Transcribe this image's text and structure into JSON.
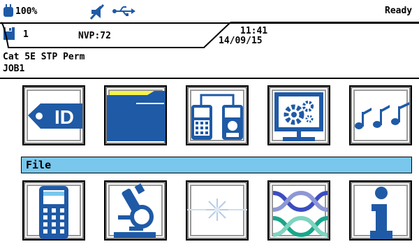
{
  "status": {
    "battery": "100%",
    "channel": "1",
    "nvp": "NVP:72",
    "time": "11:41",
    "date": "14/09/15",
    "state": "Ready"
  },
  "test": {
    "cable": "Cat 5E STP Perm",
    "job": "JOB1"
  },
  "menu": {
    "selected_label": "File",
    "row1": [
      {
        "icon": "id-tag-icon"
      },
      {
        "icon": "folder-icon"
      },
      {
        "icon": "tester-units-icon"
      },
      {
        "icon": "settings-monitor-icon"
      },
      {
        "icon": "music-notes-icon"
      }
    ],
    "row2": [
      {
        "icon": "handheld-tester-icon"
      },
      {
        "icon": "microscope-icon"
      },
      {
        "icon": "laser-icon"
      },
      {
        "icon": "twisted-pair-icon"
      },
      {
        "icon": "info-icon"
      }
    ]
  },
  "colors": {
    "accent_blue": "#1f5aa6",
    "selected_yellow": "#f5f24a",
    "label_bar": "#79c7ec"
  }
}
